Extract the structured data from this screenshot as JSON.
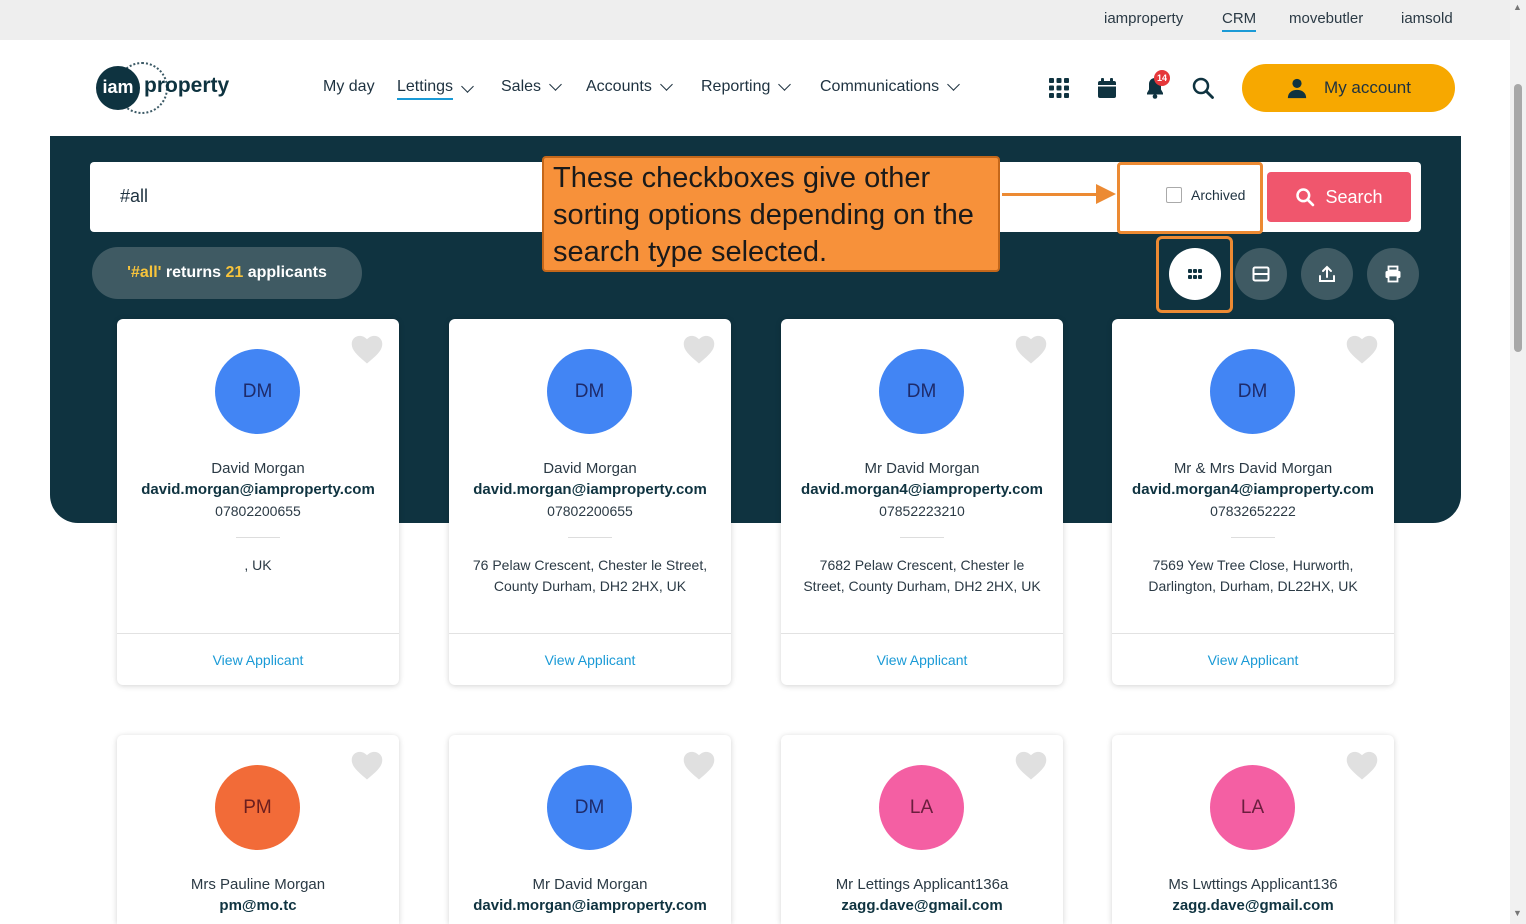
{
  "util_bar": {
    "links": [
      "iamproperty",
      "CRM",
      "movebutler",
      "iamsold"
    ]
  },
  "logo": {
    "circle": "iam",
    "text": "property"
  },
  "nav": {
    "items": [
      {
        "label": "My day"
      },
      {
        "label": "Lettings"
      },
      {
        "label": "Sales"
      },
      {
        "label": "Accounts"
      },
      {
        "label": "Reporting"
      },
      {
        "label": "Communications"
      }
    ],
    "notification_count": "14",
    "account_label": "My account"
  },
  "search": {
    "query": "#all",
    "archived_label": "Archived",
    "button_label": "Search"
  },
  "results": {
    "prefix": "'#all'",
    "mid": " returns ",
    "count": "21",
    "suffix": " applicants"
  },
  "annotation": {
    "text": "These checkboxes give other sorting options depending on the search type selected."
  },
  "colors": {
    "accent": "#f7a800",
    "hero": "#0f3340",
    "search_button": "#f0566d",
    "link": "#1a9ad6"
  },
  "cards": [
    {
      "initials": "DM",
      "avatar_color": "#4285f4",
      "name": "David Morgan",
      "email": "david.morgan@iamproperty.com",
      "phone": "07802200655",
      "address": ", UK",
      "link": "View Applicant"
    },
    {
      "initials": "DM",
      "avatar_color": "#4285f4",
      "name": "David Morgan",
      "email": "david.morgan@iamproperty.com",
      "phone": "07802200655",
      "address": "76 Pelaw Crescent, Chester le Street, County Durham, DH2 2HX, UK",
      "link": "View Applicant"
    },
    {
      "initials": "DM",
      "avatar_color": "#4285f4",
      "name": "Mr David Morgan",
      "email": "david.morgan4@iamproperty.com",
      "phone": "07852223210",
      "address": "7682 Pelaw Crescent, Chester le Street, County Durham, DH2 2HX, UK",
      "link": "View Applicant"
    },
    {
      "initials": "DM",
      "avatar_color": "#4285f4",
      "name": "Mr & Mrs David Morgan",
      "email": "david.morgan4@iamproperty.com",
      "phone": "07832652222",
      "address": "7569 Yew Tree Close, Hurworth, Darlington, Durham, DL22HX, UK",
      "link": "View Applicant"
    },
    {
      "initials": "PM",
      "avatar_color": "#f26b38",
      "name": "Mrs Pauline Morgan",
      "email": "pm@mo.tc",
      "phone": "",
      "address": "",
      "link": ""
    },
    {
      "initials": "DM",
      "avatar_color": "#4285f4",
      "name": "Mr David Morgan",
      "email": "david.morgan@iamproperty.com",
      "phone": "",
      "address": "",
      "link": ""
    },
    {
      "initials": "LA",
      "avatar_color": "#f45fa3",
      "name": "Mr Lettings Applicant136a",
      "email": "zagg.dave@gmail.com",
      "phone": "",
      "address": "",
      "link": ""
    },
    {
      "initials": "LA",
      "avatar_color": "#f45fa3",
      "name": "Ms Lwttings Applicant136",
      "email": "zagg.dave@gmail.com",
      "phone": "",
      "address": "",
      "link": ""
    }
  ]
}
